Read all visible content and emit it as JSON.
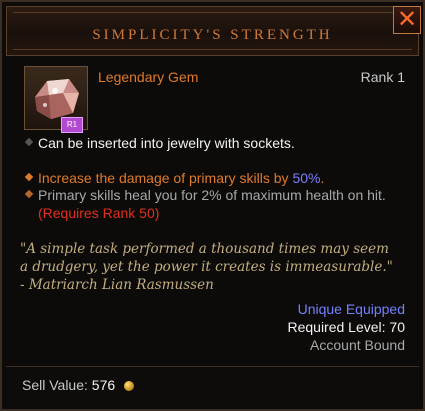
{
  "item": {
    "title": "SIMPLICITY'S STRENGTH",
    "type_label": "Legendary Gem",
    "rank_label": "Rank 1",
    "badge_text": "R1",
    "inserted_text": "Can be inserted into jewelry with sockets.",
    "stat1_prefix": "Increase the damage of primary skills by ",
    "stat1_value": "50%",
    "stat1_suffix": ".",
    "stat2_text": "Primary skills heal you for 2% of maximum health on hit.",
    "stat2_requirement": "(Requires Rank 50)",
    "flavor_line1": "\"A simple task performed a thousand times may seem",
    "flavor_line2": "a drudgery, yet the power it creates is immeasurable.\"",
    "flavor_line3": "- Matriarch Lian Rasmussen",
    "unique_equipped": "Unique Equipped",
    "required_level": "Required Level: 70",
    "account_bound": "Account Bound",
    "sell_label": "Sell Value:",
    "sell_amount": "576"
  },
  "colors": {
    "legendary_orange": "#e07a2c",
    "unique_blue": "#7680ff",
    "requirement_red": "#e0301c",
    "flavor_tan": "#c3ae80",
    "header_text": "#d07a3a"
  },
  "icons": {
    "close": "close-icon",
    "gem": "gem-icon",
    "coin": "gold-coin-icon"
  }
}
